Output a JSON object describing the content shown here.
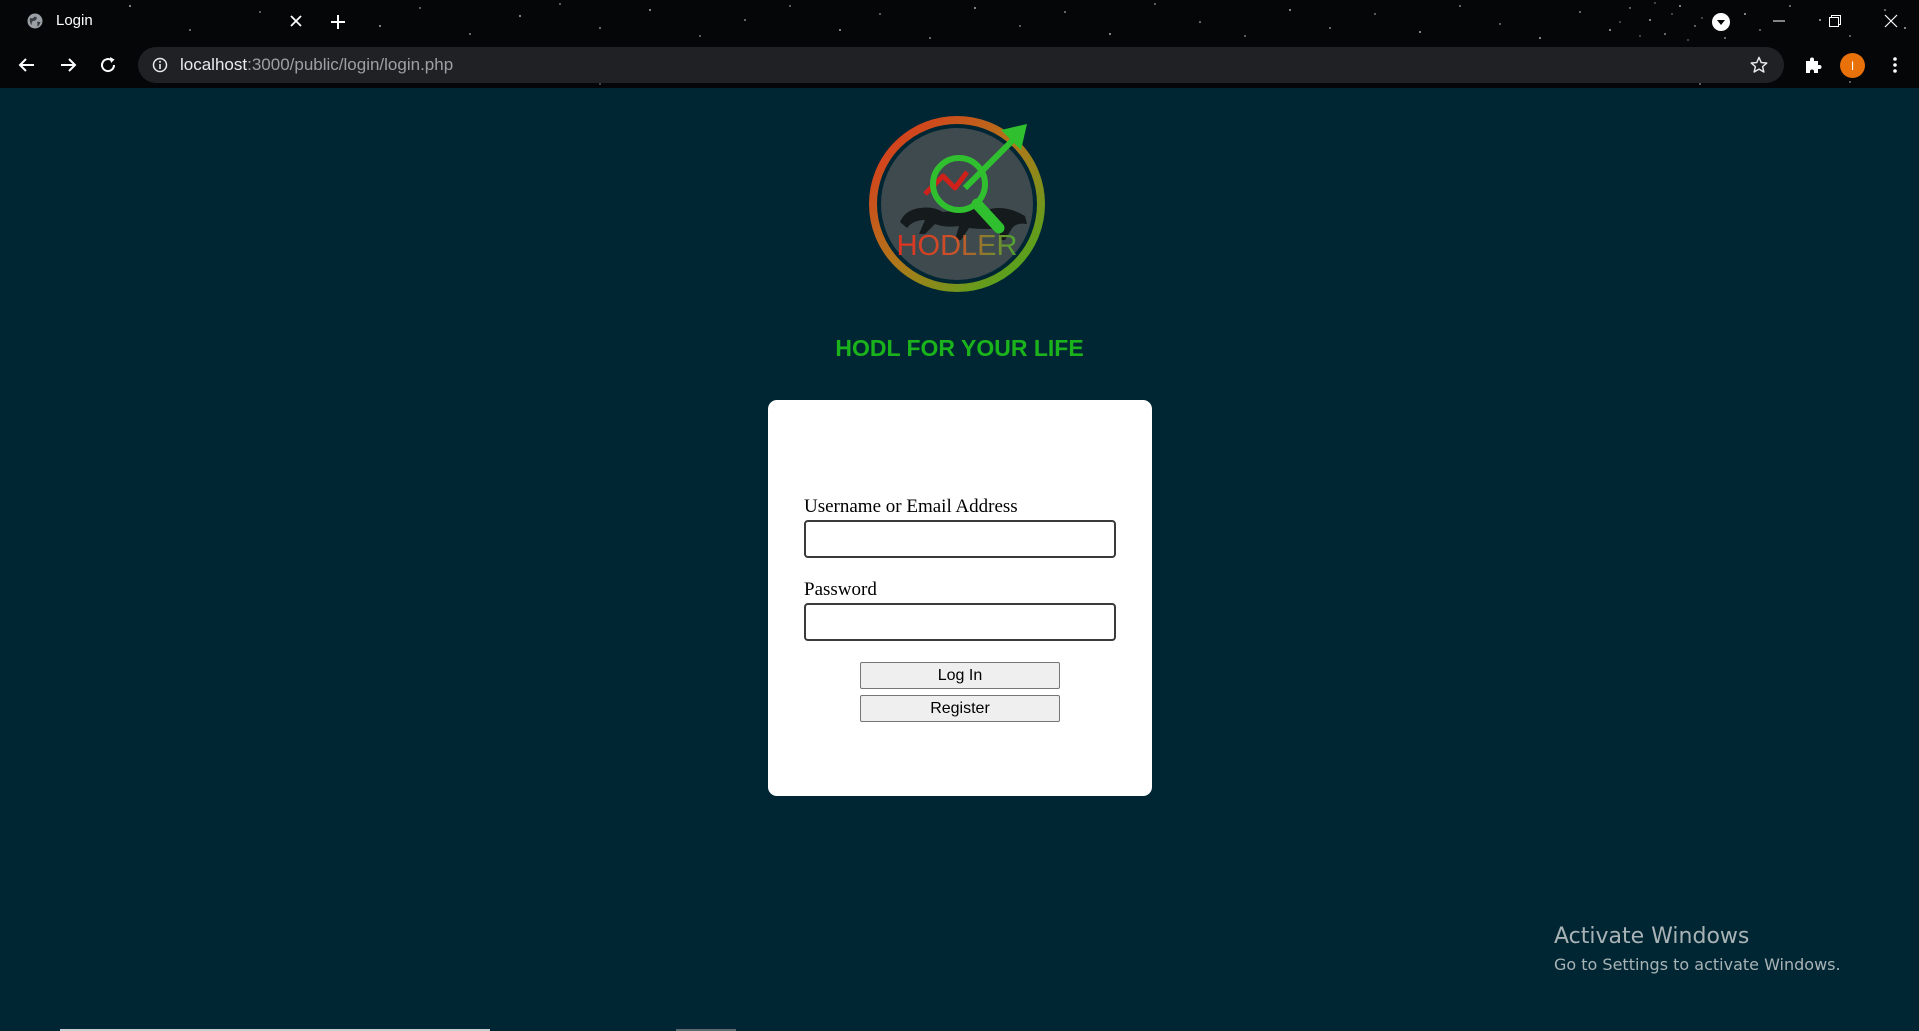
{
  "browser": {
    "tab_title": "Login",
    "url_host": "localhost",
    "url_rest": ":3000/public/login/login.php",
    "profile_initial": "I",
    "profile_color": "#e8710a",
    "icons": {
      "favicon": "globe-icon",
      "tab_close": "close-icon",
      "new_tab": "plus-icon",
      "tab_search": "chevron-down-icon",
      "minimize": "minimize-icon",
      "restore": "restore-icon",
      "close_window": "close-icon",
      "back": "arrow-left-icon",
      "forward": "arrow-right-icon",
      "reload": "reload-icon",
      "site_info": "info-icon",
      "bookmark": "star-icon",
      "extensions": "puzzle-icon",
      "menu": "kebab-menu-icon"
    }
  },
  "page": {
    "background": "#002633",
    "logo_text": "HODLER",
    "tagline": "HODL FOR YOUR LIFE",
    "tagline_color": "#1bb31b"
  },
  "login_form": {
    "username_label": "Username or Email Address",
    "username_value": "",
    "password_label": "Password",
    "password_value": "",
    "login_button": "Log In",
    "register_button": "Register"
  },
  "watermark": {
    "title": "Activate Windows",
    "subtitle": "Go to Settings to activate Windows."
  }
}
